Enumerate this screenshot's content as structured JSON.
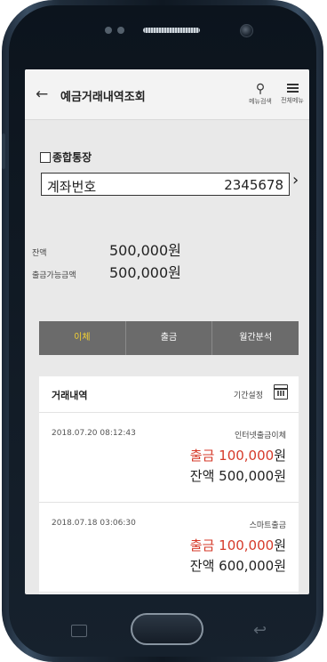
{
  "header": {
    "title": "예금거래내역조회",
    "search_label": "메뉴검색",
    "menu_label": "전체메뉴"
  },
  "account": {
    "type_label": "종합통장",
    "field_label": "계좌번호",
    "number": "2345678"
  },
  "balance": {
    "balance_label": "잔액",
    "balance_value": "500,000원",
    "available_label": "출금가능금액",
    "available_value": "500,000원"
  },
  "tabs": [
    {
      "label": "이체",
      "active": true
    },
    {
      "label": "출금",
      "active": false
    },
    {
      "label": "월간분석",
      "active": false
    }
  ],
  "history": {
    "title": "거래내역",
    "period_label": "기간설정",
    "transactions": [
      {
        "datetime": "2018.07.20 08:12:43",
        "type": "인터넷출금이체",
        "amount": "출금 100,000",
        "unit": "원",
        "balance": "잔액 500,000원"
      },
      {
        "datetime": "2018.07.18 03:06:30",
        "type": "스마트출금",
        "amount": "출금 100,000",
        "unit": "원",
        "balance": "잔액 600,000원"
      }
    ]
  },
  "colors": {
    "accent_active_tab": "#f2d033",
    "withdraw_amount": "#d63a2a",
    "tab_bar": "#6b6b6b"
  }
}
